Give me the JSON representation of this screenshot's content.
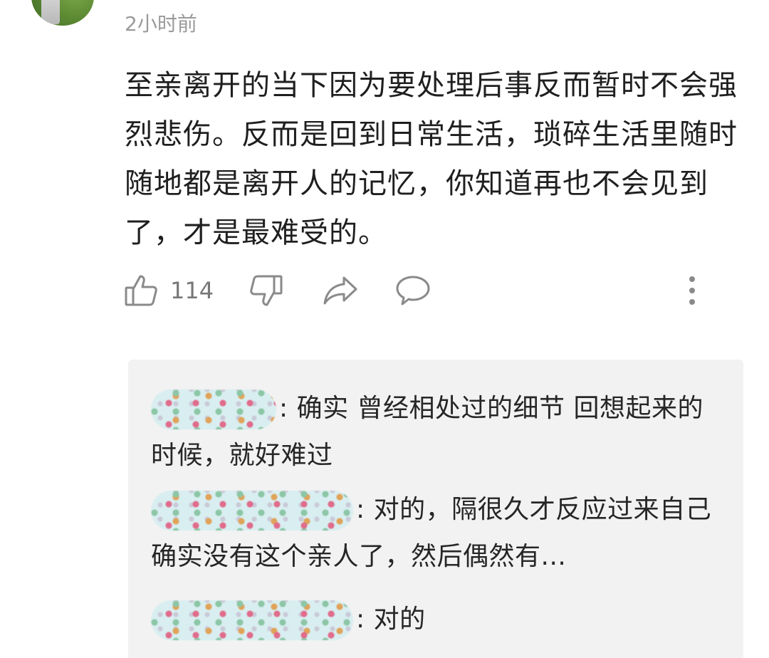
{
  "timestamp": "2小时前",
  "comment": {
    "text": "至亲离开的当下因为要处理后事反而暂时不会强烈悲伤。反而是回到日常生活，琐碎生活里随时随地都是离开人的记忆，你知道再也不会见到了，才是最难受的。",
    "likes": "114"
  },
  "actions": {
    "like_icon": "thumbs-up-icon",
    "dislike_icon": "thumbs-down-icon",
    "share_icon": "share-arrow-icon",
    "comment_icon": "speech-bubble-icon",
    "more_icon": "vertical-dots-icon"
  },
  "replies": [
    {
      "text": ": 确实 曾经相处过的细节 回想起来的时候，就好难过"
    },
    {
      "text": ": 对的，隔很久才反应过来自己确实没有这个亲人了，然后偶然有..."
    },
    {
      "text": ": 对的"
    }
  ],
  "colors": {
    "text": "#1f1f1f",
    "muted": "#9a9a9a",
    "icon": "#8a8a8a",
    "reply_bg": "#f2f2f2"
  }
}
